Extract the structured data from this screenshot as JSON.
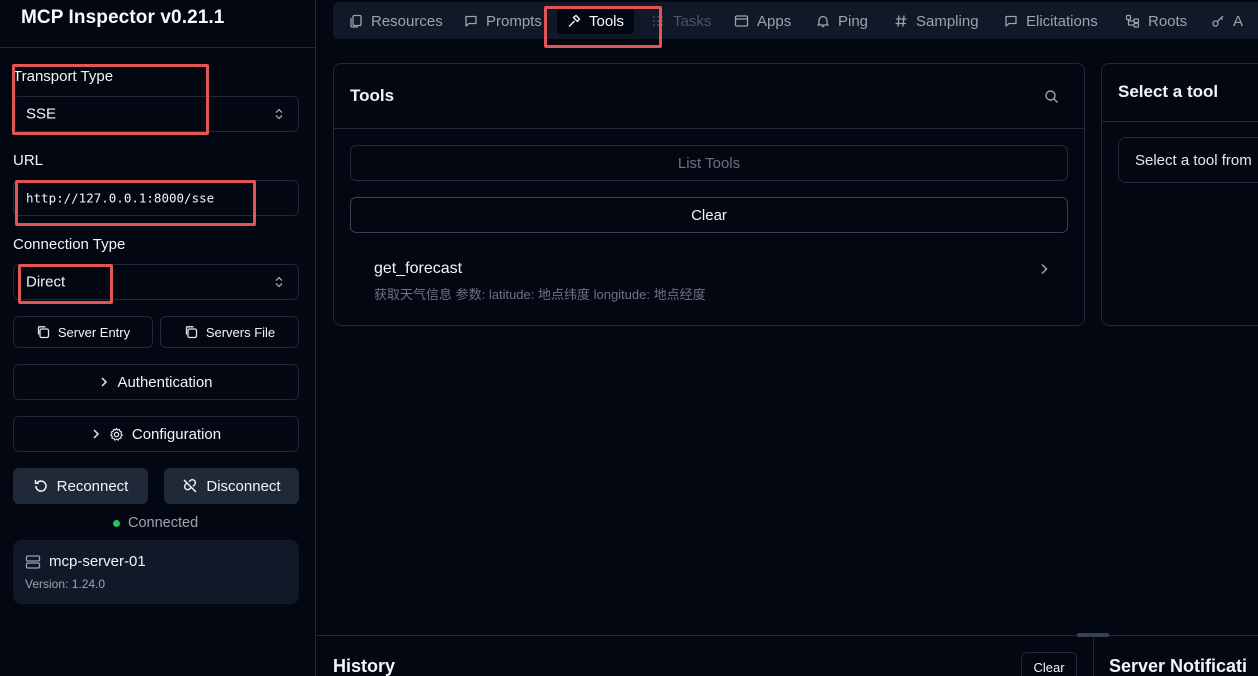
{
  "sidebar": {
    "app_title": "MCP Inspector v0.21.1",
    "transport_label": "Transport Type",
    "transport_value": "SSE",
    "url_label": "URL",
    "url_value": "http://127.0.0.1:8000/sse",
    "connection_label": "Connection Type",
    "connection_value": "Direct",
    "server_entry_label": "Server Entry",
    "servers_file_label": "Servers File",
    "authentication_label": "Authentication",
    "configuration_label": "Configuration",
    "reconnect_label": "Reconnect",
    "disconnect_label": "Disconnect",
    "status_text": "Connected",
    "status_color": "#22c55e",
    "server_name": "mcp-server-01",
    "server_version": "Version: 1.24.0"
  },
  "tabs": [
    {
      "label": "Resources",
      "icon": "files-icon"
    },
    {
      "label": "Prompts",
      "icon": "message-icon"
    },
    {
      "label": "Tools",
      "icon": "hammer-icon",
      "active": true
    },
    {
      "label": "Tasks",
      "icon": "list-icon",
      "disabled": true
    },
    {
      "label": "Apps",
      "icon": "app-window-icon"
    },
    {
      "label": "Ping",
      "icon": "bell-icon"
    },
    {
      "label": "Sampling",
      "icon": "hash-icon"
    },
    {
      "label": "Elicitations",
      "icon": "message-square-icon"
    },
    {
      "label": "Roots",
      "icon": "folder-tree-icon"
    },
    {
      "label": "A",
      "icon": "key-icon"
    }
  ],
  "tools_panel": {
    "title": "Tools",
    "list_tools_label": "List Tools",
    "clear_label": "Clear",
    "tools": [
      {
        "name": "get_forecast",
        "description": "获取天气信息 参数: latitude: 地点纬度 longitude: 地点经度"
      }
    ]
  },
  "detail_panel": {
    "title": "Select a tool",
    "placeholder": "Select a tool from"
  },
  "history": {
    "title": "History",
    "clear_label": "Clear"
  },
  "notifications": {
    "title": "Server Notificati"
  },
  "highlight_color": "#e25555"
}
